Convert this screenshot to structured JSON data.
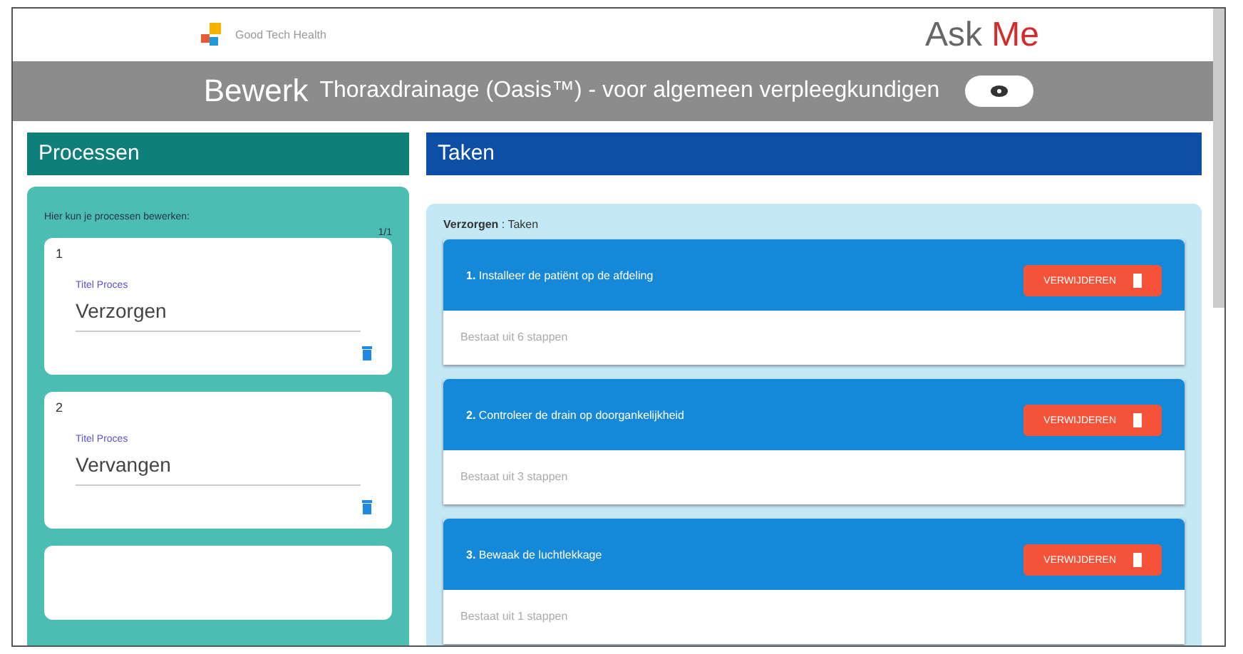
{
  "brand": {
    "name": "Good Tech Health",
    "title_plain": "Ask ",
    "title_accent": "Me"
  },
  "edit_bar": {
    "verb": "Bewerk",
    "subject": "Thoraxdrainage (Oasis™) - voor algemeen verpleegkundigen"
  },
  "processes": {
    "heading": "Processen",
    "intro": "Hier kun je processen bewerken:",
    "count": "1/1",
    "items": [
      {
        "number": "1",
        "field_label": "Titel Proces",
        "value": "Verzorgen"
      },
      {
        "number": "2",
        "field_label": "Titel Proces",
        "value": "Vervangen"
      }
    ]
  },
  "tasks": {
    "heading": "Taken",
    "crumb_bold": "Verzorgen",
    "crumb_rest": " : Taken",
    "items": [
      {
        "number": "1.",
        "title": "Installeer de patiënt op de afdeling",
        "button": "VERWIJDEREN",
        "steps": "Bestaat uit 6 stappen"
      },
      {
        "number": "2.",
        "title": "Controleer de drain op doorgankelijkheid",
        "button": "VERWIJDEREN",
        "steps": "Bestaat uit 3 stappen"
      },
      {
        "number": "3.",
        "title": "Bewaak de luchtlekkage",
        "button": "VERWIJDEREN",
        "steps": "Bestaat uit 1 stappen"
      }
    ]
  }
}
